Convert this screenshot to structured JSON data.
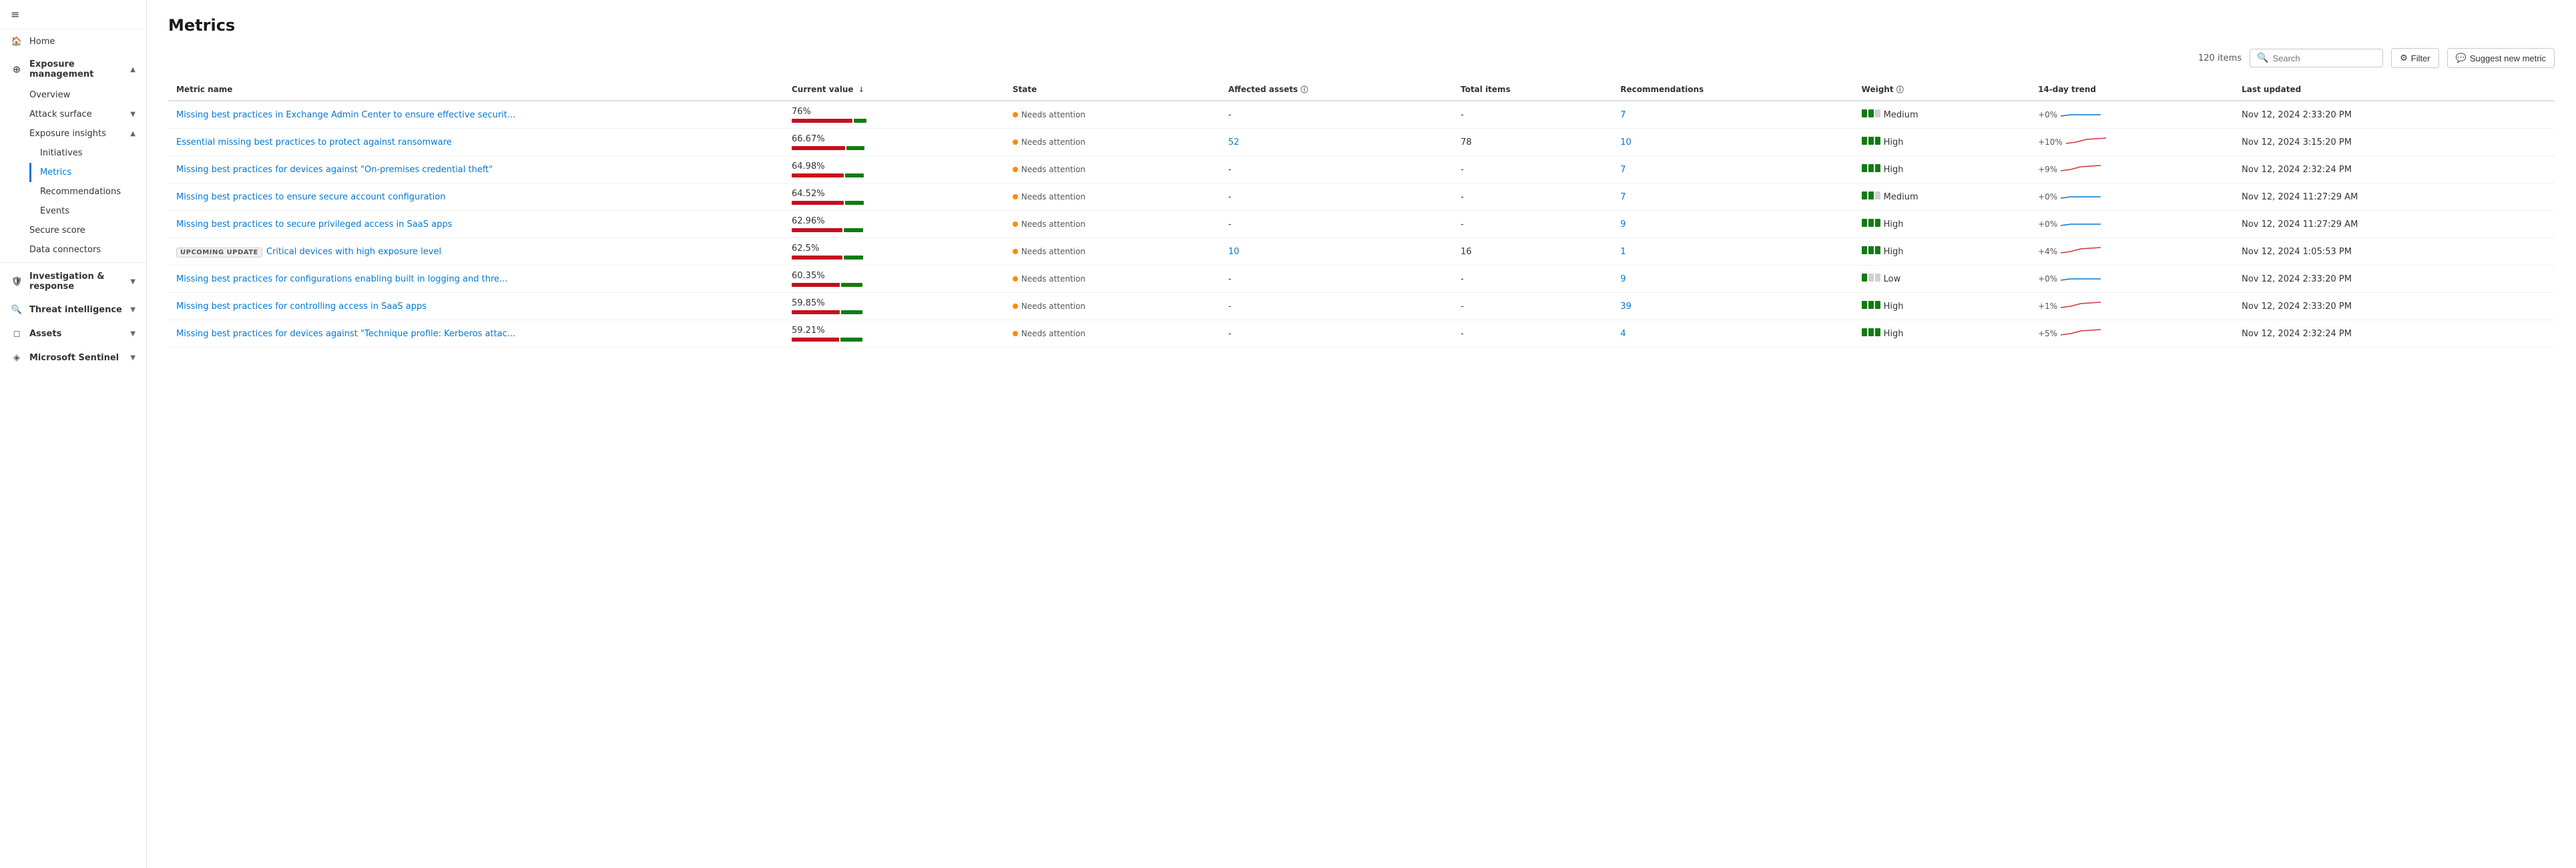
{
  "sidebar": {
    "hamburger_icon": "≡",
    "items": [
      {
        "id": "home",
        "label": "Home",
        "icon": "🏠",
        "level": 0,
        "expandable": false
      },
      {
        "id": "exposure-management",
        "label": "Exposure management",
        "icon": "⊕",
        "level": 0,
        "expandable": true,
        "expanded": true
      },
      {
        "id": "overview",
        "label": "Overview",
        "level": 1
      },
      {
        "id": "attack-surface",
        "label": "Attack surface",
        "level": 1,
        "expandable": true
      },
      {
        "id": "exposure-insights",
        "label": "Exposure insights",
        "level": 1,
        "expandable": true,
        "expanded": true
      },
      {
        "id": "initiatives",
        "label": "Initiatives",
        "level": 2
      },
      {
        "id": "metrics",
        "label": "Metrics",
        "level": 2,
        "active": true
      },
      {
        "id": "recommendations",
        "label": "Recommendations",
        "level": 2
      },
      {
        "id": "events",
        "label": "Events",
        "level": 2
      },
      {
        "id": "secure-score",
        "label": "Secure score",
        "level": 1
      },
      {
        "id": "data-connectors",
        "label": "Data connectors",
        "level": 1
      },
      {
        "id": "investigation-response",
        "label": "Investigation & response",
        "icon": "🛡",
        "level": 0,
        "expandable": true
      },
      {
        "id": "threat-intelligence",
        "label": "Threat intelligence",
        "icon": "🔍",
        "level": 0,
        "expandable": true
      },
      {
        "id": "assets",
        "label": "Assets",
        "icon": "◻",
        "level": 0,
        "expandable": true
      },
      {
        "id": "microsoft-sentinel",
        "label": "Microsoft Sentinel",
        "icon": "◈",
        "level": 0,
        "expandable": true
      }
    ]
  },
  "page": {
    "title": "Metrics",
    "item_count": "120 items"
  },
  "toolbar": {
    "search_placeholder": "Search",
    "filter_label": "Filter",
    "suggest_label": "Suggest new metric"
  },
  "table": {
    "columns": [
      {
        "id": "metric-name",
        "label": "Metric name"
      },
      {
        "id": "current-value",
        "label": "Current value",
        "sortable": true,
        "sort_direction": "desc"
      },
      {
        "id": "state",
        "label": "State"
      },
      {
        "id": "affected-assets",
        "label": "Affected assets",
        "info": true
      },
      {
        "id": "total-items",
        "label": "Total items"
      },
      {
        "id": "recommendations",
        "label": "Recommendations"
      },
      {
        "id": "weight",
        "label": "Weight",
        "info": true
      },
      {
        "id": "trend",
        "label": "14-day trend"
      },
      {
        "id": "last-updated",
        "label": "Last updated"
      }
    ],
    "rows": [
      {
        "id": 1,
        "metric_name": "Missing best practices in Exchange Admin Center to ensure effective securit...",
        "current_value": "76%",
        "bar_red_pct": 76,
        "bar_green_pct": 24,
        "state": "Needs attention",
        "affected_assets": "-",
        "total_items": "-",
        "recommendations": "7",
        "weight": "Medium",
        "weight_filled": 2,
        "weight_total": 3,
        "trend": "+0%",
        "trend_color": "blue",
        "last_updated": "Nov 12, 2024 2:33:20 PM",
        "upcoming": false
      },
      {
        "id": 2,
        "metric_name": "Essential missing best practices to protect against ransomware",
        "current_value": "66.67%",
        "bar_red_pct": 67,
        "bar_green_pct": 33,
        "state": "Needs attention",
        "affected_assets": "52",
        "total_items": "78",
        "recommendations": "10",
        "weight": "High",
        "weight_filled": 3,
        "weight_total": 3,
        "trend": "+10%",
        "trend_color": "red",
        "last_updated": "Nov 12, 2024 3:15:20 PM",
        "upcoming": false
      },
      {
        "id": 3,
        "metric_name": "Missing best practices for devices against \"On-premises credential theft\"",
        "current_value": "64.98%",
        "bar_red_pct": 65,
        "bar_green_pct": 35,
        "state": "Needs attention",
        "affected_assets": "-",
        "total_items": "-",
        "recommendations": "7",
        "weight": "High",
        "weight_filled": 3,
        "weight_total": 3,
        "trend": "+9%",
        "trend_color": "red",
        "last_updated": "Nov 12, 2024 2:32:24 PM",
        "upcoming": false
      },
      {
        "id": 4,
        "metric_name": "Missing best practices to ensure secure account configuration",
        "current_value": "64.52%",
        "bar_red_pct": 65,
        "bar_green_pct": 35,
        "state": "Needs attention",
        "affected_assets": "-",
        "total_items": "-",
        "recommendations": "7",
        "weight": "Medium",
        "weight_filled": 2,
        "weight_total": 3,
        "trend": "+0%",
        "trend_color": "blue",
        "last_updated": "Nov 12, 2024 11:27:29 AM",
        "upcoming": false
      },
      {
        "id": 5,
        "metric_name": "Missing best practices to secure privileged access in SaaS apps",
        "current_value": "62.96%",
        "bar_red_pct": 63,
        "bar_green_pct": 37,
        "state": "Needs attention",
        "affected_assets": "-",
        "total_items": "-",
        "recommendations": "9",
        "weight": "High",
        "weight_filled": 3,
        "weight_total": 3,
        "trend": "+0%",
        "trend_color": "blue",
        "last_updated": "Nov 12, 2024 11:27:29 AM",
        "upcoming": false
      },
      {
        "id": 6,
        "metric_name": "Critical devices with high exposure level",
        "current_value": "62.5%",
        "bar_red_pct": 63,
        "bar_green_pct": 37,
        "state": "Needs attention",
        "affected_assets": "10",
        "total_items": "16",
        "recommendations": "1",
        "weight": "High",
        "weight_filled": 3,
        "weight_total": 3,
        "trend": "+4%",
        "trend_color": "red",
        "last_updated": "Nov 12, 2024 1:05:53 PM",
        "upcoming": true,
        "upcoming_label": "UPCOMING UPDATE"
      },
      {
        "id": 7,
        "metric_name": "Missing best practices for configurations enabling built in logging and thre...",
        "current_value": "60.35%",
        "bar_red_pct": 60,
        "bar_green_pct": 40,
        "state": "Needs attention",
        "affected_assets": "-",
        "total_items": "-",
        "recommendations": "9",
        "weight": "Low",
        "weight_filled": 1,
        "weight_total": 3,
        "trend": "+0%",
        "trend_color": "blue",
        "last_updated": "Nov 12, 2024 2:33:20 PM",
        "upcoming": false
      },
      {
        "id": 8,
        "metric_name": "Missing best practices for controlling access in SaaS apps",
        "current_value": "59.85%",
        "bar_red_pct": 60,
        "bar_green_pct": 40,
        "state": "Needs attention",
        "affected_assets": "-",
        "total_items": "-",
        "recommendations": "39",
        "weight": "High",
        "weight_filled": 3,
        "weight_total": 3,
        "trend": "+1%",
        "trend_color": "red",
        "last_updated": "Nov 12, 2024 2:33:20 PM",
        "upcoming": false
      },
      {
        "id": 9,
        "metric_name": "Missing best practices for devices against \"Technique profile: Kerberos attac...",
        "current_value": "59.21%",
        "bar_red_pct": 59,
        "bar_green_pct": 41,
        "state": "Needs attention",
        "affected_assets": "-",
        "total_items": "-",
        "recommendations": "4",
        "weight": "High",
        "weight_filled": 3,
        "weight_total": 3,
        "trend": "+5%",
        "trend_color": "red",
        "last_updated": "Nov 12, 2024 2:32:24 PM",
        "upcoming": false
      }
    ]
  }
}
